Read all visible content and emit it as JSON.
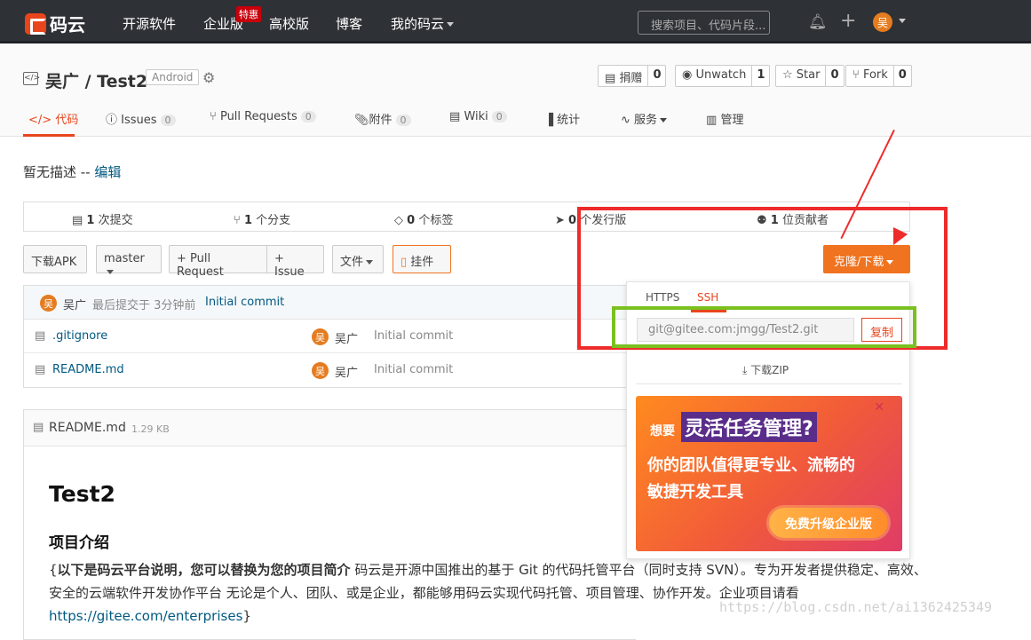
{
  "topnav": {
    "logo_text": "码云",
    "items": [
      "开源软件",
      "企业版",
      "高校版",
      "博客",
      "我的码云"
    ],
    "hot_badge": "特惠",
    "search_placeholder": "搜索项目、代码片段...",
    "avatar_initial": "吴"
  },
  "repo": {
    "title": "吴广 / Test2",
    "lang_tag": "Android",
    "actions": [
      {
        "label": "捐赠",
        "count": "0"
      },
      {
        "label": "Unwatch",
        "count": "1"
      },
      {
        "label": "Star",
        "count": "0"
      },
      {
        "label": "Fork",
        "count": "0"
      }
    ],
    "tabs": [
      {
        "label": "代码",
        "count": ""
      },
      {
        "label": "Issues",
        "count": "0"
      },
      {
        "label": "Pull Requests",
        "count": "0"
      },
      {
        "label": "附件",
        "count": "0"
      },
      {
        "label": "Wiki",
        "count": "0"
      },
      {
        "label": "统计",
        "count": ""
      },
      {
        "label": "服务",
        "count": ""
      },
      {
        "label": "管理",
        "count": ""
      }
    ]
  },
  "description": {
    "text": "暂无描述 -- ",
    "edit_link": "编辑"
  },
  "stats": [
    {
      "num": "1",
      "label": "次提交"
    },
    {
      "num": "1",
      "label": "个分支"
    },
    {
      "num": "0",
      "label": "个标签"
    },
    {
      "num": "0",
      "label": "个发行版"
    },
    {
      "num": "1",
      "label": "位贡献者"
    }
  ],
  "toolbar": {
    "download_apk": "下载APK",
    "branch": "master",
    "pull_request": "+ Pull Request",
    "issue": "+ Issue",
    "file": "文件",
    "widget": "挂件",
    "clone": "克隆/下载"
  },
  "commit": {
    "author": "吴广",
    "text": "最后提交于 3分钟前",
    "message": "Initial commit"
  },
  "files": [
    {
      "name": ".gitignore",
      "author": "吴广",
      "message": "Initial commit"
    },
    {
      "name": "README.md",
      "author": "吴广",
      "message": "Initial commit"
    }
  ],
  "readme": {
    "filename": "README.md",
    "size": "1.29 KB",
    "h1": "Test2",
    "h2": "项目介绍",
    "p_bold": "以下是码云平台说明，您可以替换为您的项目简介",
    "p_text": " 码云是开源中国推出的基于 Git 的代码托管平台（同时支持 SVN）。专为开发者提供稳定、高效、安全的云端软件开发协作平台 无论是个人、团队、或是企业，都能够用码云实现代码托管、项目管理、协作开发。企业项目请看 ",
    "p_link": "https://gitee.com/enterprises",
    "p_end": "}",
    "p_start": "{"
  },
  "clone_panel": {
    "tab_https": "HTTPS",
    "tab_ssh": "SSH",
    "url": "git@gitee.com:jmgg/Test2.git",
    "copy": "复制",
    "download_zip": "下载ZIP",
    "banner": {
      "want": "想要",
      "highlight": "灵活任务管理?",
      "line1": "你的团队值得更专业、流畅的",
      "line2": "敏捷开发工具",
      "cta": "免费升级企业版"
    }
  },
  "watermark": "https://blog.csdn.net/ai1362425349",
  "colors": {
    "accent": "#e8451d",
    "clone_button": "#f0731f",
    "red_annotation": "#ee2b2b",
    "green_annotation": "#7ac01f"
  }
}
